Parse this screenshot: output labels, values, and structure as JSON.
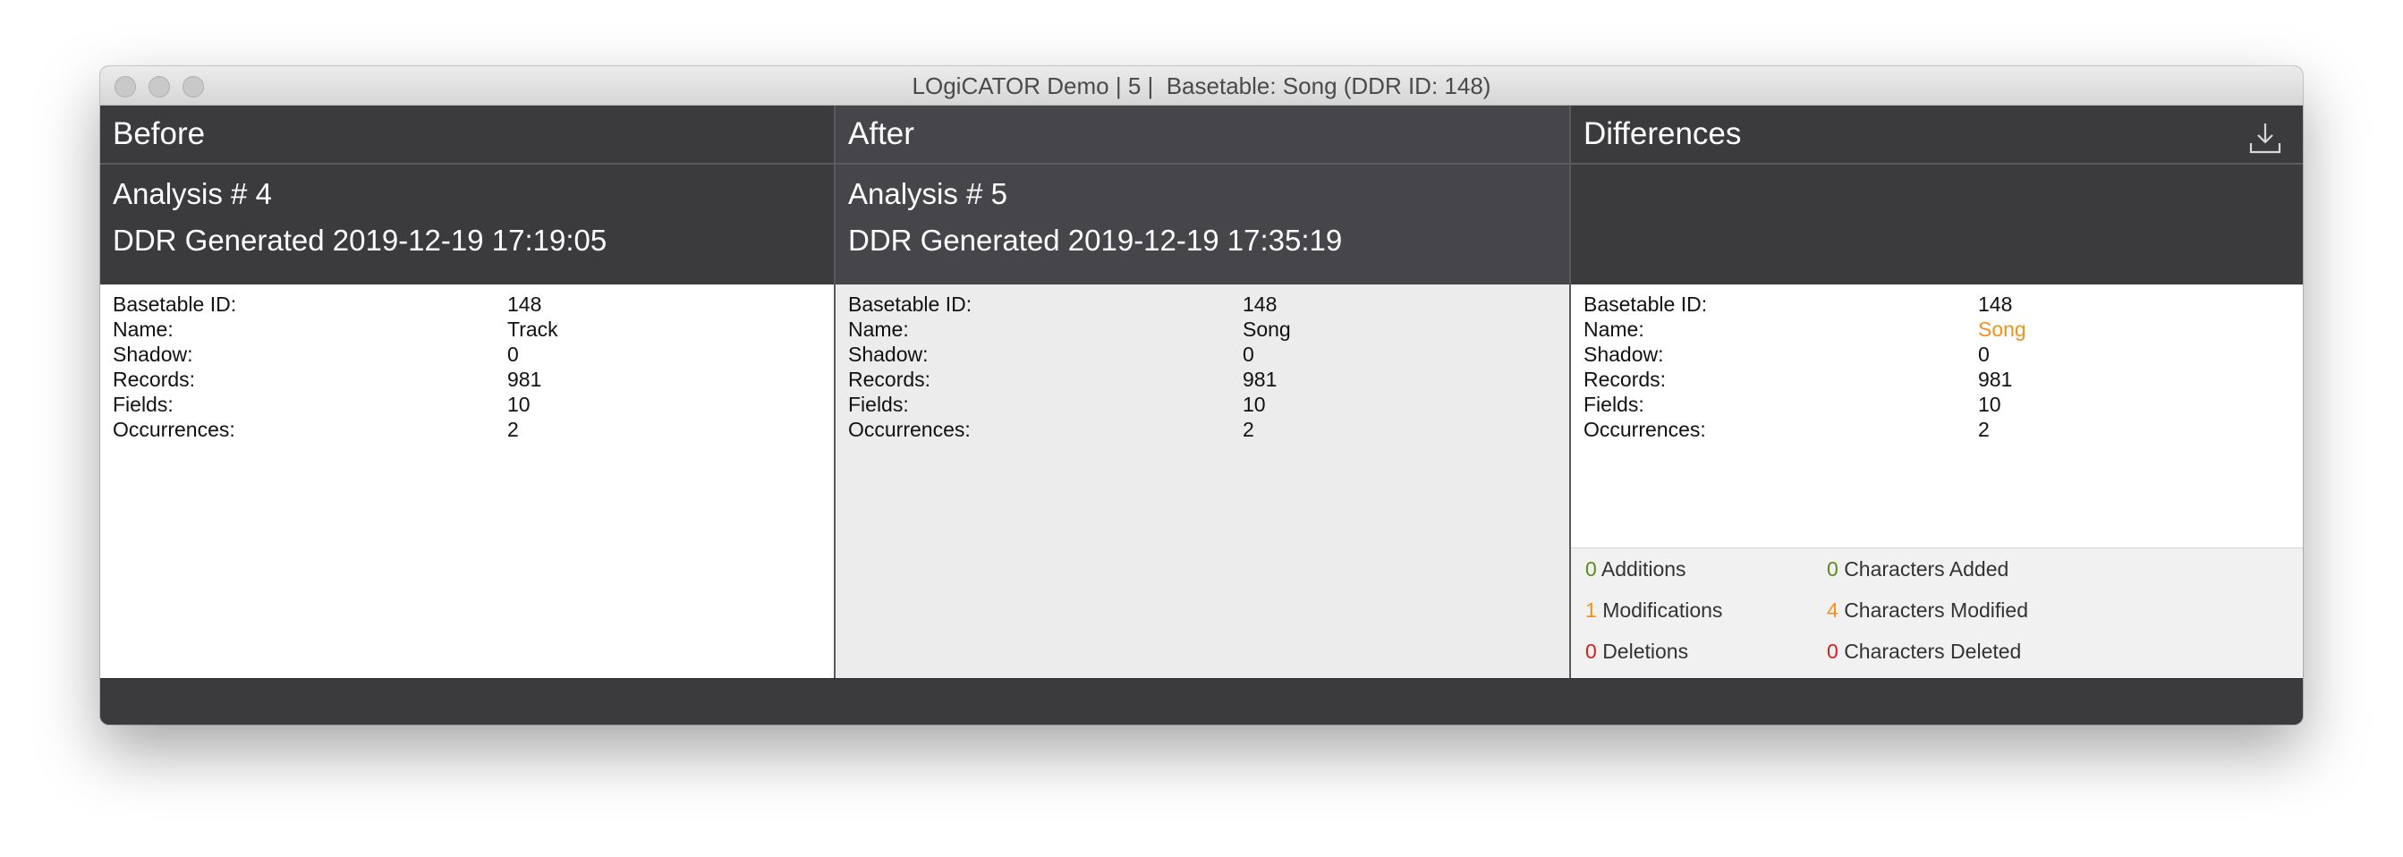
{
  "window": {
    "title": "LOgiCATOR Demo | 5 |  Basetable: Song (DDR ID: 148)"
  },
  "columns": {
    "before": {
      "header": "Before",
      "analysis": "Analysis # 4",
      "generated": "DDR Generated 2019-12-19 17:19:05",
      "props": [
        {
          "key": "Basetable ID:",
          "value": "148"
        },
        {
          "key": "Name:",
          "value": "Track"
        },
        {
          "key": "Shadow:",
          "value": "0"
        },
        {
          "key": "Records:",
          "value": "981"
        },
        {
          "key": "Fields:",
          "value": "10"
        },
        {
          "key": "Occurrences:",
          "value": "2"
        }
      ]
    },
    "after": {
      "header": "After",
      "analysis": "Analysis # 5",
      "generated": "DDR Generated 2019-12-19 17:35:19",
      "props": [
        {
          "key": "Basetable ID:",
          "value": "148"
        },
        {
          "key": "Name:",
          "value": "Song"
        },
        {
          "key": "Shadow:",
          "value": "0"
        },
        {
          "key": "Records:",
          "value": "981"
        },
        {
          "key": "Fields:",
          "value": "10"
        },
        {
          "key": "Occurrences:",
          "value": "2"
        }
      ]
    },
    "differences": {
      "header": "Differences",
      "download_icon": "download-icon",
      "props": [
        {
          "key": "Basetable ID:",
          "value": "148"
        },
        {
          "key": "Name:",
          "value": "Song"
        },
        {
          "key": "Shadow:",
          "value": "0"
        },
        {
          "key": "Records:",
          "value": "981"
        },
        {
          "key": "Fields:",
          "value": "10"
        },
        {
          "key": "Occurrences:",
          "value": "2"
        }
      ],
      "summary": {
        "additions_count": "0",
        "additions_label": "Additions",
        "modifications_count": "1",
        "modifications_label": "Modifications",
        "deletions_count": "0",
        "deletions_label": "Deletions",
        "chars_added_count": "0",
        "chars_added_label": "Characters Added",
        "chars_modified_count": "4",
        "chars_modified_label": "Characters Modified",
        "chars_deleted_count": "0",
        "chars_deleted_label": "Characters Deleted"
      }
    }
  },
  "colors": {
    "header_bg": "#3b3b3e",
    "changed_value": "#f0921d",
    "additions": "#5b8c1e",
    "modifications": "#f0921d",
    "deletions": "#d02020"
  }
}
